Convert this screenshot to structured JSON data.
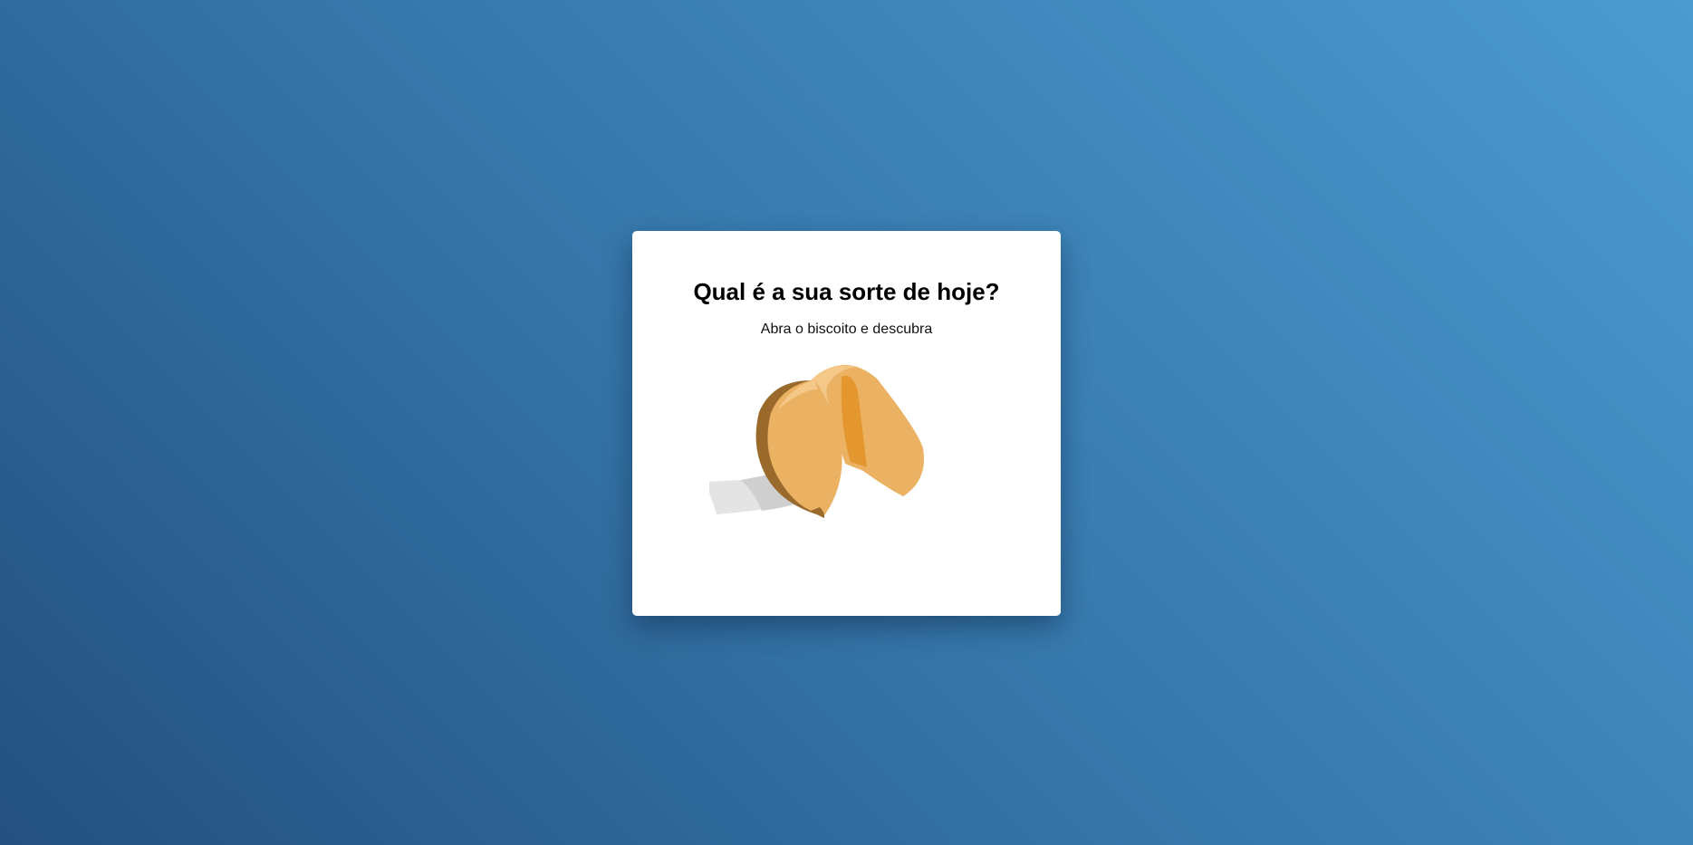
{
  "card": {
    "title": "Qual é a sua sorte de hoje?",
    "subtitle": "Abra o biscoito e descubra"
  },
  "cookie": {
    "icon": "fortune-cookie-icon"
  },
  "colors": {
    "background_start": "#23507f",
    "background_end": "#4b9ad0",
    "card": "#ffffff",
    "cookie_body": "#ebb263",
    "cookie_inner": "#e5972f",
    "cookie_shadow": "#9a6a2d",
    "paper": "#e4e4e4"
  }
}
